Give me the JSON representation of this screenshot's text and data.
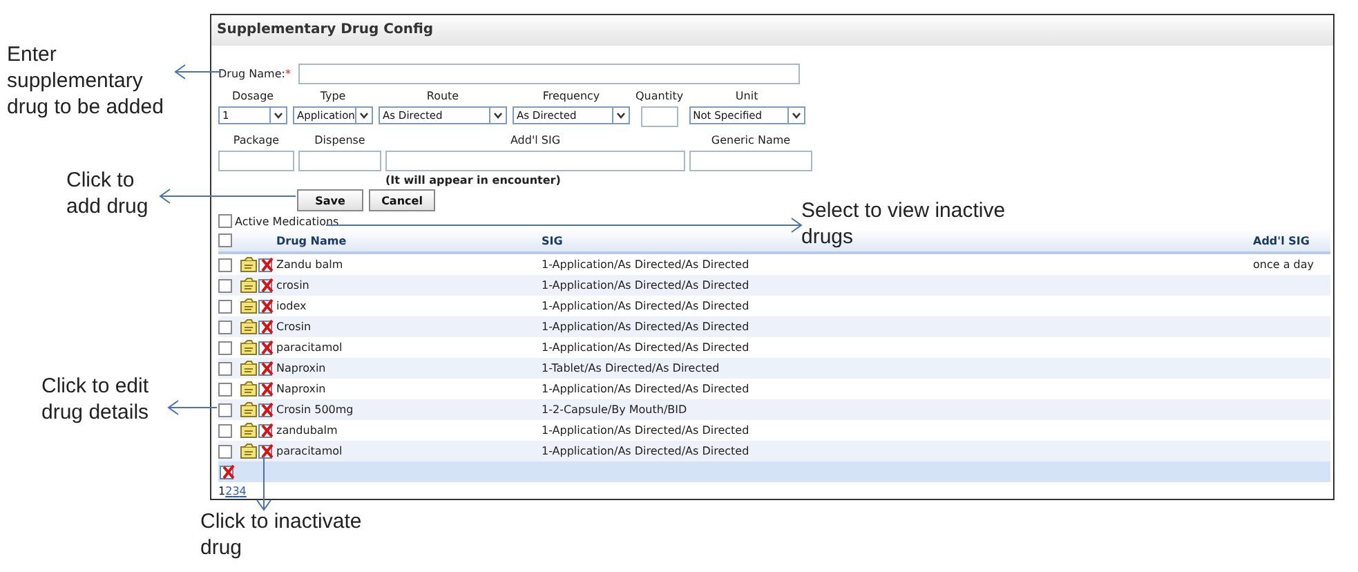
{
  "annotations": [
    {
      "text": "Enter supplementary drug to be added"
    },
    {
      "text": "Click to add drug"
    },
    {
      "text": "Select to view inactive drugs"
    },
    {
      "text": "Click to edit drug details"
    },
    {
      "text": "Click to inactivate drug"
    }
  ],
  "panel": {
    "title": "Supplementary Drug Config",
    "drug_name": {
      "label": "Drug Name:",
      "required_mark": "*"
    },
    "fields_row_1": [
      {
        "label": "Dosage",
        "kind": "select",
        "value": "1"
      },
      {
        "label": "Type",
        "kind": "select",
        "value": "Application"
      },
      {
        "label": "Route",
        "kind": "select",
        "value": "As Directed"
      },
      {
        "label": "Frequency",
        "kind": "select",
        "value": "As Directed"
      },
      {
        "label": "Quantity",
        "kind": "input"
      },
      {
        "label": "Unit",
        "kind": "select",
        "value": "Not Specified"
      }
    ],
    "fields_row_2": [
      {
        "label": "Package",
        "kind": "input"
      },
      {
        "label": "Dispense",
        "kind": "input"
      },
      {
        "label": "Add'l SIG",
        "kind": "input"
      },
      {
        "label": "Generic Name",
        "kind": "input"
      }
    ],
    "note": "(It will appear in encounter)",
    "buttons": [
      "Save",
      "Cancel"
    ],
    "active_medications": {
      "label": "Active Medications",
      "checked": false
    },
    "table": {
      "header_checked": false,
      "columns": [
        "Drug Name",
        "SIG",
        "Add'l SIG"
      ],
      "rows": [
        {
          "checked": false,
          "drug_name": "Zandu balm",
          "sig": "1-Application/As Directed/As Directed",
          "addl_sig": "once a day"
        },
        {
          "checked": false,
          "drug_name": "crosin",
          "sig": "1-Application/As Directed/As Directed"
        },
        {
          "checked": false,
          "drug_name": "iodex",
          "sig": "1-Application/As Directed/As Directed"
        },
        {
          "checked": false,
          "drug_name": "Crosin",
          "sig": "1-Application/As Directed/As Directed"
        },
        {
          "checked": false,
          "drug_name": "paracitamol",
          "sig": "1-Application/As Directed/As Directed"
        },
        {
          "checked": false,
          "drug_name": "Naproxin",
          "sig": "1-Tablet/As Directed/As Directed"
        },
        {
          "checked": false,
          "drug_name": "Naproxin",
          "sig": "1-Application/As Directed/As Directed"
        },
        {
          "checked": false,
          "drug_name": "Crosin 500mg",
          "sig": "1-2-Capsule/By Mouth/BID"
        },
        {
          "checked": false,
          "drug_name": "zandubalm",
          "sig": "1-Application/As Directed/As Directed"
        },
        {
          "checked": false,
          "drug_name": "paracitamol",
          "sig": "1-Application/As Directed/As Directed"
        }
      ]
    },
    "pagination": [
      {
        "label": "1",
        "selected": true
      },
      {
        "label": "2",
        "selected": false
      },
      {
        "label": "3",
        "selected": false
      },
      {
        "label": "4",
        "selected": false
      }
    ]
  }
}
